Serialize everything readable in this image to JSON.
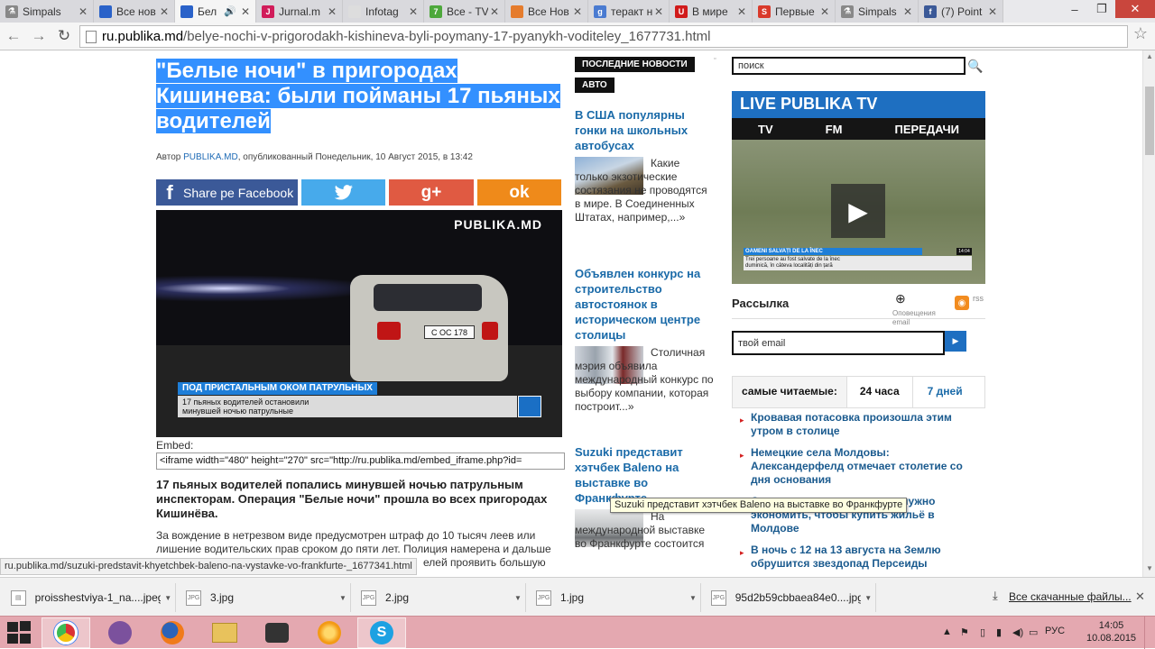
{
  "browser": {
    "tabs": [
      {
        "title": "Simpals",
        "icon_color": "#555555",
        "icon_glyph": "⚗"
      },
      {
        "title": "Все нов",
        "icon_color": "#2a62c9",
        "icon_glyph": "▣"
      },
      {
        "title": "Бел",
        "icon_color": "#2a62c9",
        "icon_glyph": "▣",
        "active": true
      },
      {
        "title": "Jurnal.m",
        "icon_color": "#d11c5a",
        "icon_glyph": "J"
      },
      {
        "title": "Infotag",
        "icon_color": "#cccccc",
        "icon_glyph": " "
      },
      {
        "title": "Все - TV",
        "icon_color": "#4da83b",
        "icon_glyph": "7"
      },
      {
        "title": "Все Нов",
        "icon_color": "#e57c2d",
        "icon_glyph": "✎"
      },
      {
        "title": "теракт н",
        "icon_color": "#4a7bd1",
        "icon_glyph": "g"
      },
      {
        "title": "В мире",
        "icon_color": "#d11b1b",
        "icon_glyph": "U"
      },
      {
        "title": "Первые",
        "icon_color": "#d93a2b",
        "icon_glyph": "S"
      },
      {
        "title": "Simpals",
        "icon_color": "#555555",
        "icon_glyph": "⚗"
      },
      {
        "title": "(7) Point",
        "icon_color": "#3b5998",
        "icon_glyph": "f"
      }
    ],
    "address": {
      "host": "ru.publika.md",
      "path": "/belye-nochi-v-prigorodakh-kishineva-byli-poymany-17-pyanykh-voditeley_1677731.html"
    }
  },
  "article": {
    "title_quote": "\"",
    "title": "Белые ночи\" в пригородах Кишинева: были пойманы 17 пьяных водителей",
    "byline_prefix": "Автор ",
    "byline_author": "PUBLIKA.MD",
    "byline_suffix": ", опубликованный Понедельник, 10 Август 2015, в 13:42",
    "share_facebook": "Share pe Facebook",
    "share_twitter_icon": "twitter-bird",
    "share_gplus": "g+",
    "share_ok": "ok",
    "video": {
      "brand": "PUBLIKA.MD",
      "plate": "C OC 178",
      "caption_top": "ПОД ПРИСТАЛЬНЫМ ОКОМ ПАТРУЛЬНЫХ",
      "caption_line1": "17 пьяных водителей остановили",
      "caption_line2": "минувшей ночью патрульные"
    },
    "embed_label": "Embed:",
    "embed_code": "<iframe width=\"480\" height=\"270\" src=\"http://ru.publika.md/embed_iframe.php?id=",
    "lead": "17 пьяных водителей попались минувшей ночью патрульным инспекторам. Операция \"Белые ночи\" прошла во всех пригородах Кишинёва.",
    "body_line1": "За вождение в нетрезвом виде предусмотрен штраф до 10 тысяч леев или",
    "body_line2": "лишение водительских прав сроком до пяти лет.  Полиция намерена и дальше",
    "body_line3": "елей проявить большую"
  },
  "news": {
    "label_latest": "ПОСЛЕДНИЕ НОВОСТИ",
    "label_auto": "АВТО",
    "items": [
      {
        "title": "В США популярны гонки на школьных автобусах",
        "text_first": "Какие только",
        "text_rest": "экзотические состязания не проводятся в мире. В Соединенных Штатах, например,...»"
      },
      {
        "title": "Объявлен конкурс на строительство автостоянок в историческом центре столицы",
        "text_first": "Столичная мэрия объявила",
        "text_rest": "международный конкурс по выбору компании, которая построит...»"
      },
      {
        "title": "Suzuki представит хэтчбек Baleno на выставке во Франкфурте",
        "text_first": "На",
        "text_rest": "международной выставке во Франкфурте состоится"
      }
    ]
  },
  "sidebar": {
    "search_placeholder": "поиск",
    "live_title": "LIVE PUBLIKA TV",
    "live_tabs": [
      "TV",
      "FM",
      "ПЕРЕДАЧИ"
    ],
    "ticker_top": "OAMENI SALVAȚI DE LA ÎNEC",
    "ticker_line1": "Trei persoane au fost salvate de la înec",
    "ticker_line2": "duminică, în câteva localități din țară",
    "ticker_clock": "14:04",
    "newsletter_label": "Рассылка",
    "notif_label": "Оповещения email",
    "rss_label": "rss",
    "email_placeholder": "твой email",
    "popular_label": "самые читаемые:",
    "popular_24": "24 часа",
    "popular_7": "7 дней",
    "popular_items": [
      "Кровавая потасовка произошла этим утром в столице",
      "Немецкие села Молдовы: Александерфелд отмечает столетие со дня основания",
      "Сколько денег молдаванам нужно экономить, чтобы купить жильё в Молдове",
      "В ночь с 12 на 13 августа на Землю обрушится звездопад Персеиды"
    ]
  },
  "tooltip": "Suzuki представит хэтчбек Baleno на выставке во Франкфурте",
  "status_url": "ru.publika.md/suzuki-predstavit-khyetchbek-baleno-na-vystavke-vo-frankfurte-_1677341.html",
  "downloads": {
    "items": [
      "proisshestviya-1_na....jpeg",
      "3.jpg",
      "2.jpg",
      "1.jpg",
      "95d2b59cbbaea84e0....jpg"
    ],
    "all_label": "Все скачанные файлы..."
  },
  "taskbar": {
    "lang": "РУС",
    "time": "14:05",
    "date": "10.08.2015"
  }
}
